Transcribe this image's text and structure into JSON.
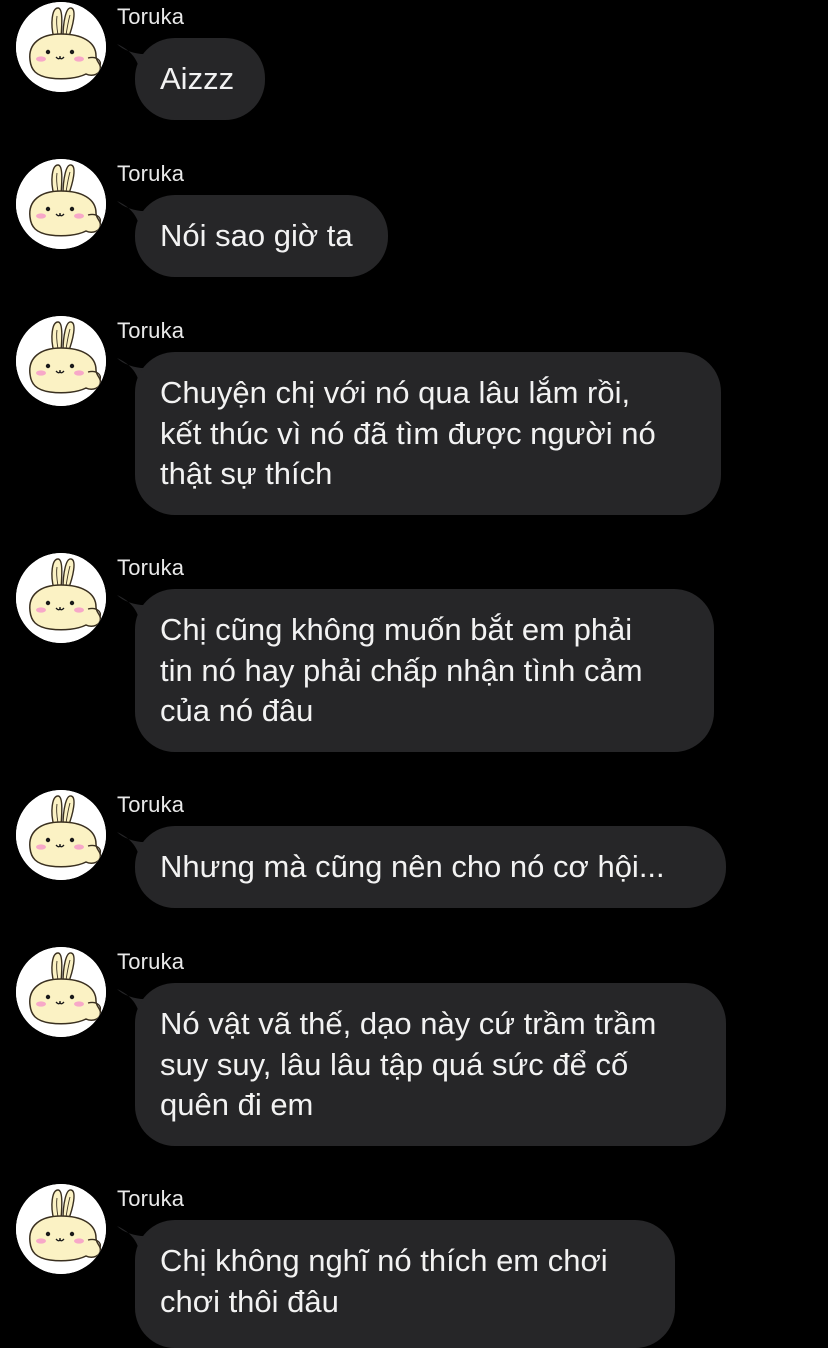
{
  "chat": {
    "messages": [
      {
        "sender": "Toruka",
        "avatar_icon": "bunny-avatar-icon",
        "text": "Aizzz"
      },
      {
        "sender": "Toruka",
        "avatar_icon": "bunny-avatar-icon",
        "text": "Nói sao giờ ta"
      },
      {
        "sender": "Toruka",
        "avatar_icon": "bunny-avatar-icon",
        "text": "Chuyện chị với nó qua lâu lắm rồi,\nkết thúc vì nó đã tìm được người nó\nthật sự thích"
      },
      {
        "sender": "Toruka",
        "avatar_icon": "bunny-avatar-icon",
        "text": "Chị cũng không muốn bắt em phải\ntin nó hay phải chấp nhận tình cảm\ncủa nó đâu"
      },
      {
        "sender": "Toruka",
        "avatar_icon": "bunny-avatar-icon",
        "text": "Nhưng mà cũng nên cho nó cơ hội..."
      },
      {
        "sender": "Toruka",
        "avatar_icon": "bunny-avatar-icon",
        "text": "Nó vật vã thế, dạo này cứ trầm trầm\nsuy suy, lâu lâu tập quá sức để cố\nquên đi em"
      },
      {
        "sender": "Toruka",
        "avatar_icon": "bunny-avatar-icon",
        "text": "Chị không nghĩ nó thích em chơi\nchơi thôi đâu"
      }
    ]
  },
  "colors": {
    "background": "#000000",
    "bubble": "#262628",
    "bubble_text": "#f2f2f2",
    "sender_text": "#e9e9e9",
    "avatar_bg": "#ffffff",
    "bunny_body": "#fbf2c4",
    "bunny_cheek": "#f7a8c8"
  }
}
